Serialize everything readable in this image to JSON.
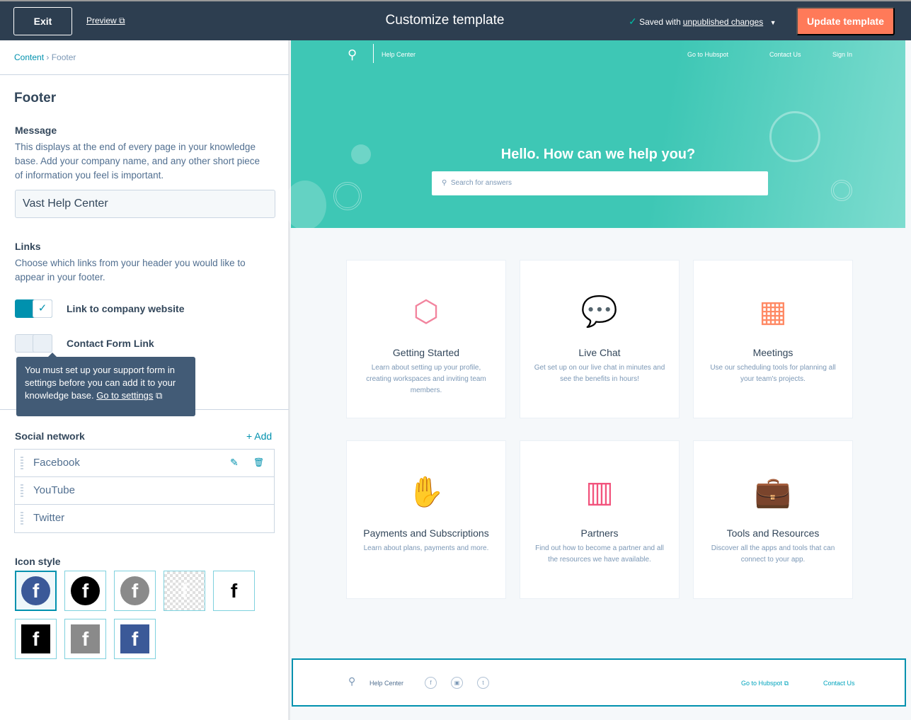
{
  "topbar": {
    "exit": "Exit",
    "preview": "Preview",
    "title": "Customize template",
    "saved_prefix": "Saved with",
    "saved_link": "unpublished changes",
    "update": "Update template"
  },
  "breadcrumb": {
    "root": "Content",
    "current": "Footer"
  },
  "panel": {
    "title": "Footer",
    "message_label": "Message",
    "message_desc": "This displays at the end of every page in your knowledge base. Add your company name, and any other short piece of information you feel is important.",
    "message_value": "Vast Help Center",
    "links_label": "Links",
    "links_desc": "Choose which links from your header you would like to appear in your footer.",
    "toggles": [
      {
        "label": "Link to company website",
        "on": true
      },
      {
        "label": "Contact Form Link",
        "on": false
      }
    ],
    "tooltip": "You must set up your support form in settings before you can add it to your knowledge base.",
    "tooltip_link": "Go to settings",
    "social_label": "Social network",
    "add": "+ Add",
    "social": [
      "Facebook",
      "YouTube",
      "Twitter"
    ],
    "icon_style_label": "Icon style",
    "icon_styles": [
      {
        "shape": "circle",
        "bg": "#3b5998",
        "selected": true
      },
      {
        "shape": "circle",
        "bg": "#000000"
      },
      {
        "shape": "circle",
        "bg": "#8a8a8a"
      },
      {
        "shape": "transparent",
        "bg": "transparent"
      },
      {
        "shape": "plain",
        "bg": "#ffffff"
      },
      {
        "shape": "square",
        "bg": "#000000"
      },
      {
        "shape": "square",
        "bg": "#8a8a8a"
      },
      {
        "shape": "square",
        "bg": "#3b5998"
      }
    ]
  },
  "site": {
    "brand": "Help Center",
    "nav": [
      "Go to Hubspot",
      "Contact Us",
      "Sign In"
    ],
    "hero_title": "Hello. How can we help you?",
    "search_placeholder": "Search for answers",
    "cards": [
      {
        "title": "Getting Started",
        "desc": "Learn about setting up your profile, creating workspaces and inviting team members.",
        "icon": "cube-icon",
        "color": "#f2849e"
      },
      {
        "title": "Live Chat",
        "desc": "Get set up on our live chat in minutes and see the benefits in hours!",
        "icon": "chat-icon",
        "color": "#a78bdb"
      },
      {
        "title": "Meetings",
        "desc": "Use our scheduling tools for planning all your team's projects.",
        "icon": "calendar-icon",
        "color": "#ff8a65"
      },
      {
        "title": "Payments and Subscriptions",
        "desc": "Learn about plans, payments and more.",
        "icon": "handshake-icon",
        "color": "#ffab8a"
      },
      {
        "title": "Partners",
        "desc": "Find out how to become a partner and all the resources we have available.",
        "icon": "building-icon",
        "color": "#f2547d"
      },
      {
        "title": "Tools and Resources",
        "desc": "Discover all the apps and tools that can connect to your app.",
        "icon": "briefcase-icon",
        "color": "#5c62c4"
      }
    ],
    "footer": {
      "brand": "Help Center",
      "links": [
        "Go to Hubspot",
        "Contact Us"
      ]
    }
  }
}
